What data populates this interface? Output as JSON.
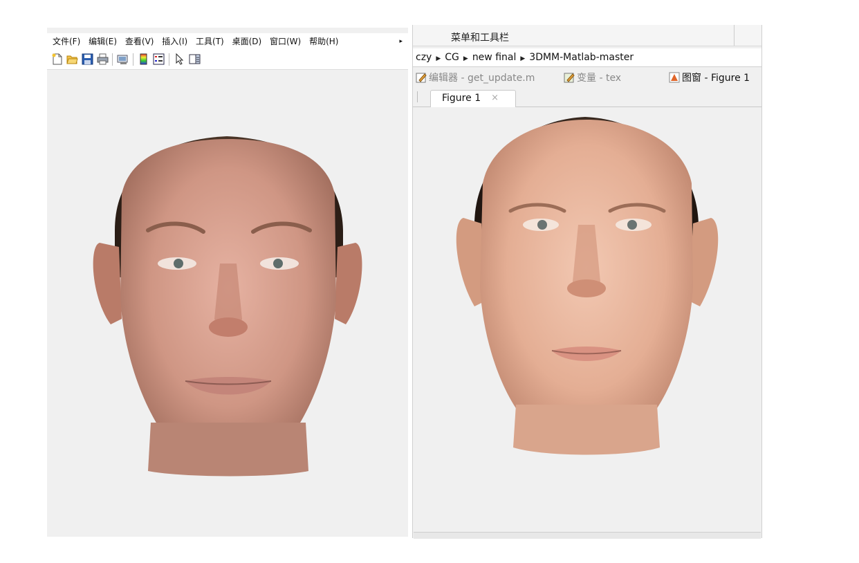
{
  "left_window": {
    "menu": [
      {
        "label": "文件(F)"
      },
      {
        "label": "编辑(E)"
      },
      {
        "label": "查看(V)"
      },
      {
        "label": "插入(I)"
      },
      {
        "label": "工具(T)"
      },
      {
        "label": "桌面(D)"
      },
      {
        "label": "窗口(W)"
      },
      {
        "label": "帮助(H)"
      }
    ],
    "menu_overflow": "▸",
    "toolbar_icons": [
      "new-file-icon",
      "open-folder-icon",
      "save-icon",
      "print-icon",
      "print-preview-icon",
      "colorbar-icon",
      "legend-icon",
      "pointer-icon",
      "property-editor-icon"
    ]
  },
  "right_window": {
    "toolstrip_label": "菜单和工具栏",
    "address_path": [
      "czy",
      "CG",
      "new final",
      "3DMM-Matlab-master"
    ],
    "desktop_tabs": [
      {
        "label": "编辑器 - get_update.m",
        "icon": "editor-icon"
      },
      {
        "label": "变量 - tex",
        "icon": "variable-icon"
      },
      {
        "label": "图窗 - Figure 1",
        "icon": "figure-icon"
      }
    ],
    "figure_tab": {
      "label": "Figure 1",
      "close": "×"
    }
  },
  "colors": {
    "canvas_bg": "#f0f0f0",
    "left_face_skin": "#d9a08e",
    "right_face_skin": "#e8b8a0",
    "hair": "#3a2a22"
  }
}
